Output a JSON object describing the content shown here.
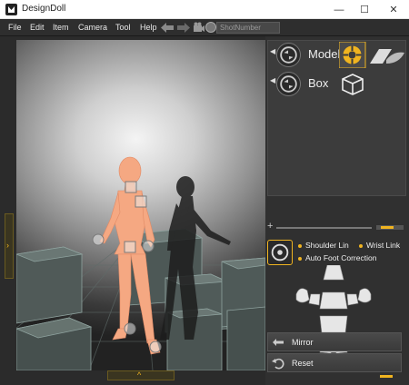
{
  "window": {
    "title": "DesignDoll",
    "minimize": "—",
    "maximize": "☐",
    "close": "✕"
  },
  "menu": {
    "file": "File",
    "edit": "Edit",
    "item": "Item",
    "camera": "Camera",
    "tool": "Tool",
    "help": "Help"
  },
  "toolbar": {
    "snap_field": "ShotNumber"
  },
  "left_toggle": {
    "glyph": "›"
  },
  "bottom_toggle": {
    "glyph": "^"
  },
  "library": {
    "rows": [
      {
        "label": "Model"
      },
      {
        "label": "Box"
      }
    ],
    "expander": "◀"
  },
  "slider": {
    "plus": "+"
  },
  "options": {
    "shoulder_link": "Shoulder Lin",
    "wrist_link": "Wrist Link",
    "auto_foot": "Auto Foot Correction"
  },
  "actions": {
    "mirror": "Mirror",
    "reset": "Reset"
  },
  "colors": {
    "accent": "#f0b420",
    "panel": "#303030",
    "skin": "#f5a882"
  }
}
